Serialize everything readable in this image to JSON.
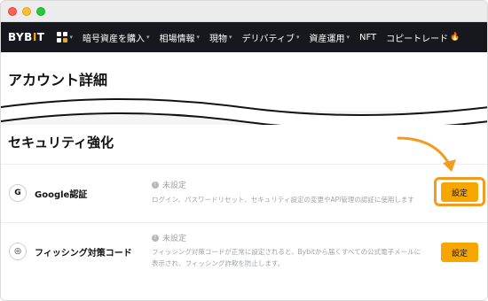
{
  "brand": {
    "logo_left": "BYB",
    "logo_bar": "I",
    "logo_right": "T"
  },
  "nav": {
    "items": [
      {
        "label": "暗号資産を購入",
        "has_caret": true
      },
      {
        "label": "相場情報",
        "has_caret": true
      },
      {
        "label": "現物",
        "has_caret": true
      },
      {
        "label": "デリバティブ",
        "has_caret": true
      },
      {
        "label": "資産運用",
        "has_caret": true
      },
      {
        "label": "NFT",
        "has_caret": false
      },
      {
        "label": "コピートレード",
        "has_caret": false
      }
    ],
    "caret": "▾",
    "flame": "🔥"
  },
  "account": {
    "title": "アカウント詳細"
  },
  "security": {
    "title": "セキュリティ強化",
    "rows": [
      {
        "icon": "google-icon",
        "icon_glyph": "G",
        "label": "Google認証",
        "status": "未設定",
        "description": "ログイン、パスワードリセット、セキュリティ設定の変更やAPI管理の認証に使用します",
        "button": "設定"
      },
      {
        "icon": "phishing-code-icon",
        "icon_glyph": "◎",
        "label": "フィッシング対策コード",
        "status": "未設定",
        "description_line1": "フィッシング対策コードが正常に設定されると、Bybitから届くすべての公式電子メールに",
        "description_line2": "表示され、フィッシング詐欺を防止します。",
        "button": "設定"
      }
    ]
  },
  "colors": {
    "accent": "#f7a600",
    "highlight": "#f29c1f",
    "nav_bg": "#17181e"
  }
}
